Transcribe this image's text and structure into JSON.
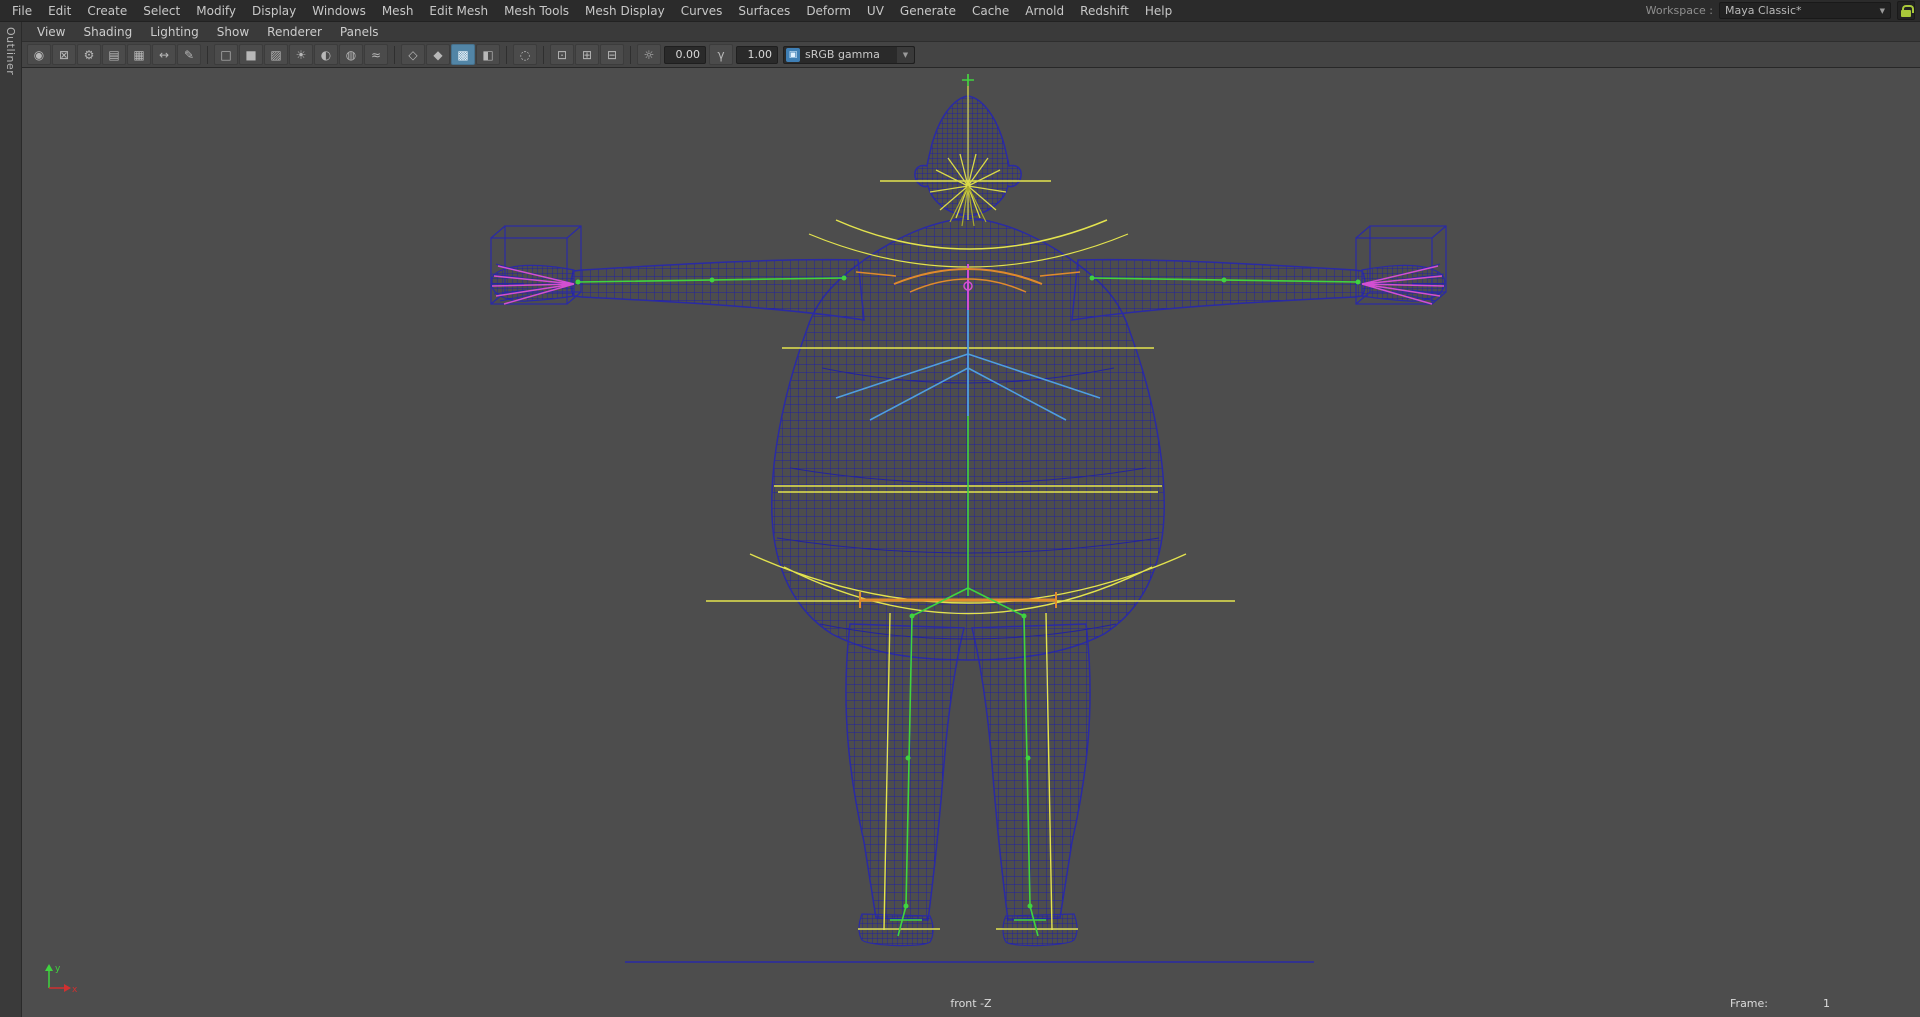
{
  "colors": {
    "viewport_bg": "#4d4d4d",
    "menubar_bg": "#2b2b2b",
    "panel_bg": "#3a3a3a",
    "toolbar_bg": "#444444",
    "wireframe": "#2a2aa5",
    "wireframe_grid": "#22229e",
    "rig_yellow": "#e3e34e",
    "rig_olive": "#a8a832",
    "rig_green": "#3fd43f",
    "rig_blue": "#4f9fe0",
    "rig_orange": "#e08a2d",
    "rig_magenta": "#d24fd2",
    "active_icon_bg": "#5285a6",
    "lock_green": "#a9c93a"
  },
  "main_menu": {
    "items": [
      "File",
      "Edit",
      "Create",
      "Select",
      "Modify",
      "Display",
      "Windows",
      "Mesh",
      "Edit Mesh",
      "Mesh Tools",
      "Mesh Display",
      "Curves",
      "Surfaces",
      "Deform",
      "UV",
      "Generate",
      "Cache",
      "Arnold",
      "Redshift",
      "Help"
    ]
  },
  "workspace": {
    "label": "Workspace :",
    "value": "Maya Classic*",
    "arrow": "▼"
  },
  "outliner_panel": {
    "label": "Outliner"
  },
  "panel_menu": {
    "items": [
      "View",
      "Shading",
      "Lighting",
      "Show",
      "Renderer",
      "Panels"
    ]
  },
  "toolbar": {
    "icons": [
      {
        "name": "select-camera-icon",
        "glyph": "◉"
      },
      {
        "name": "lock-camera-icon",
        "glyph": "⊠"
      },
      {
        "name": "camera-attributes-icon",
        "glyph": "⚙"
      },
      {
        "name": "bookmarks-icon",
        "glyph": "▤"
      },
      {
        "name": "image-plane-icon",
        "glyph": "▦"
      },
      {
        "name": "2d-pan-zoom-icon",
        "glyph": "↔"
      },
      {
        "name": "grease-pencil-icon",
        "glyph": "✎"
      },
      {
        "name": "wireframe-mode-icon",
        "glyph": "□"
      },
      {
        "name": "smooth-shade-mode-icon",
        "glyph": "■"
      },
      {
        "name": "textured-mode-icon",
        "glyph": "▨"
      },
      {
        "name": "use-all-lights-icon",
        "glyph": "☀"
      },
      {
        "name": "shadows-icon",
        "glyph": "◐"
      },
      {
        "name": "screen-space-ao-icon",
        "glyph": "◍"
      },
      {
        "name": "motion-blur-icon",
        "glyph": "≈"
      },
      {
        "name": "xray-icon",
        "glyph": "◇"
      },
      {
        "name": "xray-joints-icon",
        "glyph": "◆"
      },
      {
        "name": "wireframe-on-shaded-icon",
        "glyph": "▩"
      },
      {
        "name": "default-material-icon",
        "glyph": "◧"
      },
      {
        "name": "isolate-select-icon",
        "glyph": "◌"
      },
      {
        "name": "gate-mask-icon",
        "glyph": "⊡"
      },
      {
        "name": "field-chart-icon",
        "glyph": "⊞"
      },
      {
        "name": "safe-action-icon",
        "glyph": "⊟"
      },
      {
        "name": "exposure-icon",
        "glyph": "☼"
      },
      {
        "name": "gamma-icon",
        "glyph": "γ"
      },
      {
        "name": "color-management-icon",
        "glyph": "▣"
      }
    ],
    "exposure_value": "0.00",
    "gamma_value": "1.00",
    "view_transform": "sRGB gamma",
    "dropdown_arrow": "▼"
  },
  "viewport": {
    "camera_label": "front -Z",
    "frame_label": "Frame:",
    "frame_value": "1"
  }
}
